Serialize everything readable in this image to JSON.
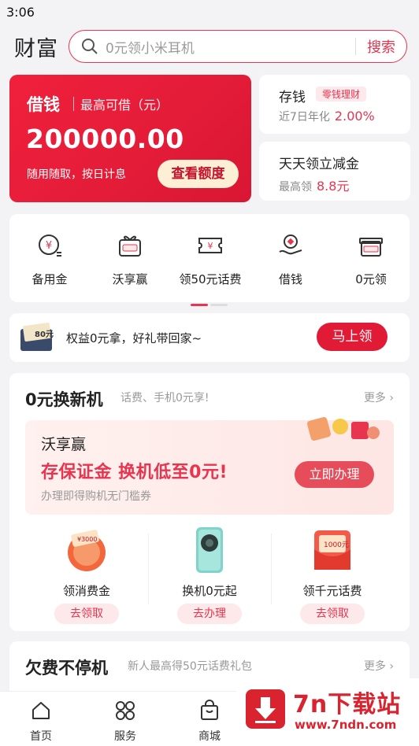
{
  "status": {
    "time": "3:06"
  },
  "header": {
    "title": "财富",
    "search_placeholder": "0元领小米耳机",
    "search_button": "搜索"
  },
  "loan_card": {
    "title": "借钱",
    "subtitle": "最高可借（元）",
    "amount": "200000.00",
    "desc": "随用随取，按日计息",
    "cta": "查看额度"
  },
  "deposit_card": {
    "title": "存钱",
    "tag": "零钱理财",
    "sub": "近7日年化",
    "value": "2.00%"
  },
  "discount_card": {
    "title": "天天领立减金",
    "sub": "最高领",
    "value": "8.8元"
  },
  "quick_grid": [
    {
      "label": "备用金",
      "icon": "yuan-coin-icon"
    },
    {
      "label": "沃享赢",
      "icon": "gift-box-icon"
    },
    {
      "label": "领50元话费",
      "icon": "ticket-icon"
    },
    {
      "label": "借钱",
      "icon": "hand-coin-icon"
    },
    {
      "label": "0元领",
      "icon": "gift-icon"
    }
  ],
  "promo": {
    "badge": "80元",
    "text": "权益0元拿，好礼带回家~",
    "button": "马上领"
  },
  "section_phone": {
    "title": "0元换新机",
    "subtitle": "话费、手机0元享!",
    "more": "更多",
    "banner": {
      "title": "沃享赢",
      "headline": "存保证金 换机低至0元!",
      "desc": "办理即得购机无门槛券",
      "button": "立即办理"
    },
    "offers": [
      {
        "label": "领消费金",
        "button": "去领取",
        "icon": "voucher-icon",
        "badge": "¥3000"
      },
      {
        "label": "换机0元起",
        "button": "去办理",
        "icon": "phone-icon"
      },
      {
        "label": "领千元话费",
        "button": "去领取",
        "icon": "red-envelope-icon",
        "badge": "1000元"
      }
    ]
  },
  "section_arrears": {
    "title": "欠费不停机",
    "subtitle": "新人最高得50元话费礼包",
    "more": "更多"
  },
  "tabbar": [
    {
      "label": "首页",
      "icon": "home-icon"
    },
    {
      "label": "服务",
      "icon": "grid-icon"
    },
    {
      "label": "商城",
      "icon": "shopping-bag-icon"
    }
  ],
  "watermark": {
    "name": "7n下载站",
    "url": "www.7ndn.com"
  },
  "colors": {
    "accent": "#e8344f",
    "loan_bg": "#e31c38"
  }
}
